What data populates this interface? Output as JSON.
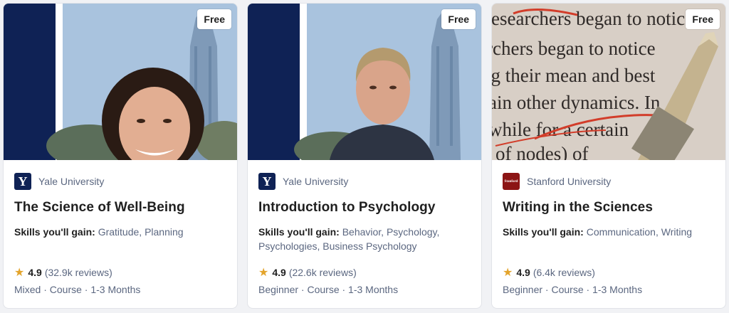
{
  "cards": [
    {
      "badge": "Free",
      "partner": "Yale University",
      "logo_text": "Y",
      "title": "The Science of Well-Being",
      "skills_label": "Skills you'll gain:",
      "skills": "Gratitude, Planning",
      "rating": "4.9",
      "reviews": "(32.9k reviews)",
      "meta": "Mixed · Course · 1-3 Months"
    },
    {
      "badge": "Free",
      "partner": "Yale University",
      "logo_text": "Y",
      "title": "Introduction to Psychology",
      "skills_label": "Skills you'll gain:",
      "skills": "Behavior, Psychology, Psychologies, Business Psychology",
      "rating": "4.9",
      "reviews": "(22.6k reviews)",
      "meta": "Beginner · Course · 1-3 Months"
    },
    {
      "badge": "Free",
      "partner": "Stanford University",
      "logo_text": "Stanford",
      "title": "Writing in the Sciences",
      "skills_label": "Skills you'll gain:",
      "skills": "Communication, Writing",
      "rating": "4.9",
      "reviews": "(6.4k reviews)",
      "meta": "Beginner · Course · 1-3 Months"
    }
  ],
  "colors": {
    "yale_navy": "#0f2255",
    "stanford_red": "#8c1515",
    "star": "#e3a42b"
  }
}
